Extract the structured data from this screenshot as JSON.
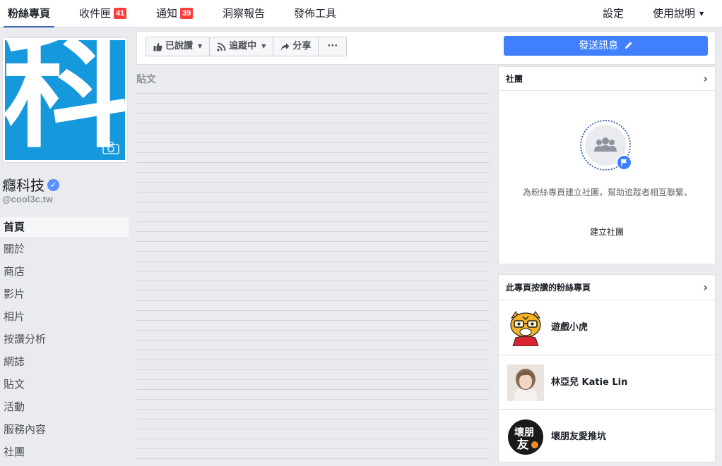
{
  "topnav": {
    "tabs": [
      {
        "label": "粉絲專頁"
      },
      {
        "label": "收件匣",
        "badge": "41"
      },
      {
        "label": "通知",
        "badge": "39"
      },
      {
        "label": "洞察報告"
      },
      {
        "label": "發佈工具"
      }
    ],
    "settings": "設定",
    "help": "使用說明",
    "help_caret": "▼"
  },
  "page": {
    "cover_char": "科",
    "name": "癮科技",
    "verified": "✓",
    "handle": "@cool3c.tw"
  },
  "leftnav": {
    "items": [
      "首頁",
      "關於",
      "商店",
      "影片",
      "相片",
      "按讚分析",
      "網誌",
      "貼文",
      "活動",
      "服務內容",
      "社團"
    ]
  },
  "actionbar": {
    "liked": "已說讚",
    "following": "追蹤中",
    "share": "分享",
    "more": "···",
    "dropdown": "▼",
    "send_message": "發送訊息"
  },
  "posts": {
    "label": "貼文"
  },
  "groups_card": {
    "title": "社團",
    "chevron": "›",
    "description": "為粉絲專頁建立社團，幫助追蹤者相互聯繫。",
    "create": "建立社團"
  },
  "liked_pages_card": {
    "title": "此專頁按讚的粉絲專頁",
    "chevron": "›",
    "pages": [
      {
        "name": "遊戲小虎"
      },
      {
        "name": "林亞兒 Katie Lin"
      },
      {
        "name": "壞朋友愛推坑",
        "avatar_text": "壞朋友"
      }
    ]
  },
  "colors": {
    "brand_blue": "#4267b2",
    "cover_blue": "#1698dc",
    "send_button": "#4080ff",
    "badge_red": "#fa3e3e"
  }
}
